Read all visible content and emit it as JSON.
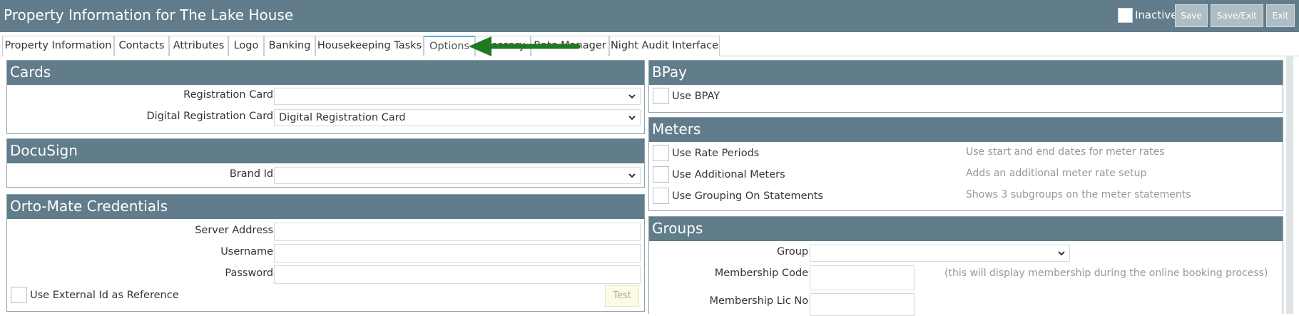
{
  "header": {
    "title": "Property Information for The Lake House",
    "inactive_label": "Inactive",
    "buttons": {
      "save": "Save",
      "save_exit": "Save/Exit",
      "exit": "Exit"
    }
  },
  "tabs": [
    {
      "label": "Property Information"
    },
    {
      "label": "Contacts"
    },
    {
      "label": "Attributes"
    },
    {
      "label": "Logo"
    },
    {
      "label": "Banking"
    },
    {
      "label": "Housekeeping Tasks"
    },
    {
      "label": "Options",
      "active": true
    },
    {
      "label": "Glossary"
    },
    {
      "label": "Rate Manager"
    },
    {
      "label": "Night Audit Interface"
    }
  ],
  "cards": {
    "heading": "Cards",
    "registration_card_label": "Registration Card:",
    "registration_card_value": "",
    "digital_registration_card_label": "Digital Registration Card:",
    "digital_registration_card_value": "Digital Registration Card"
  },
  "docusign": {
    "heading": "DocuSign",
    "brand_id_label": "Brand Id:",
    "brand_id_value": ""
  },
  "ortomate": {
    "heading": "Orto-Mate Credentials",
    "server_address_label": "Server Address:",
    "username_label": "Username:",
    "password_label": "Password:",
    "use_external_id_label": "Use External Id as Reference",
    "test_button": "Test"
  },
  "bpay": {
    "heading": "BPay",
    "use_bpay_label": "Use BPAY"
  },
  "meters": {
    "heading": "Meters",
    "options": [
      {
        "label": "Use Rate Periods",
        "hint": "Use start and end dates for meter rates"
      },
      {
        "label": "Use Additional Meters",
        "hint": "Adds an additional meter rate setup"
      },
      {
        "label": "Use Grouping On Statements",
        "hint": "Shows 3 subgroups on the meter statements"
      }
    ]
  },
  "groups": {
    "heading": "Groups",
    "group_label": "Group:",
    "group_value": "",
    "membership_code_label": "Membership Code:",
    "membership_code_hint": "(this will display membership during the online booking process)",
    "membership_lic_label": "Membership Lic No:"
  },
  "colors": {
    "header_bg": "#617d8b",
    "active_tab_accent": "#5ab0d6",
    "annotation_arrow": "#1f7a1f"
  }
}
